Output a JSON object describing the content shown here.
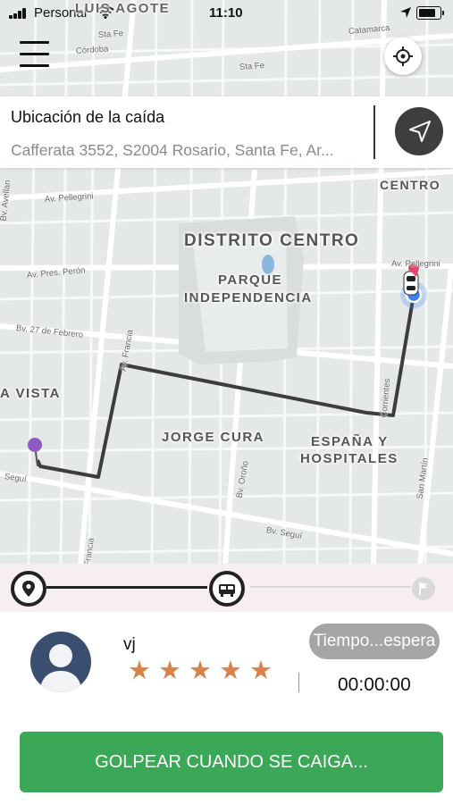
{
  "status_bar": {
    "carrier": "Personal",
    "time": "11:10"
  },
  "map": {
    "labels": {
      "distrito_centro": "DISTRITO CENTRO",
      "parque_line1": "PARQUE",
      "parque_line2": "INDEPENDENCIA",
      "jorge_cura": "JORGE CURA",
      "espana_line1": "ESPAÑA Y",
      "espana_line2": "HOSPITALES",
      "vista": "A VISTA",
      "centro": "CENTRO",
      "top_partial": "LUIS AGOTE"
    },
    "streets": {
      "sta_fe_1": "Sta Fe",
      "sta_fe_2": "Sta Fe",
      "cordoba": "Córdoba",
      "catamarca": "Catamarca",
      "pellegrini_1": "Av. Pellegrini",
      "pellegrini_2": "Av. Pellegrini",
      "pres_peron": "Av. Pres. Perón",
      "bv_27_febrero": "Bv. 27 de Febrero",
      "av_francia_1": "Av. Francia",
      "francia_2": "Francia",
      "corrientes": "Corrientes",
      "orono": "Bv. Oroño",
      "san_martin": "San Martín",
      "bv_segui_1": "Seguí",
      "bv_segui_2": "Bv. Seguí",
      "bv_avellaneda": "Bv. Avellan"
    }
  },
  "destination": {
    "title": "Ubicación de la caída",
    "address": "Cafferata 3552, S2004 Rosario, Santa Fe, Ar..."
  },
  "driver": {
    "name": "vj",
    "stars": [
      "★",
      "★",
      "★",
      "★",
      "★"
    ],
    "wait_label": "Tiempo...espera",
    "timer": "00:00:00"
  },
  "action": {
    "label": "GOLPEAR CUANDO SE CAIGA..."
  },
  "colors": {
    "action_green": "#3aa856",
    "star_orange": "#d9824a",
    "route": "#3d3d3d",
    "pin_purple": "#8e5bc4",
    "pin_red": "#e0456b",
    "current_location_blue": "#3b82f6",
    "avatar_bg": "#3a4f6f",
    "wait_pill": "#a5a5a5"
  },
  "icons": {
    "menu": "hamburger-icon",
    "recenter": "crosshair-icon",
    "navigate": "navigation-arrow-icon",
    "pickup": "location-pin-icon",
    "vehicle": "car-icon",
    "dropoff": "flag-icon"
  }
}
